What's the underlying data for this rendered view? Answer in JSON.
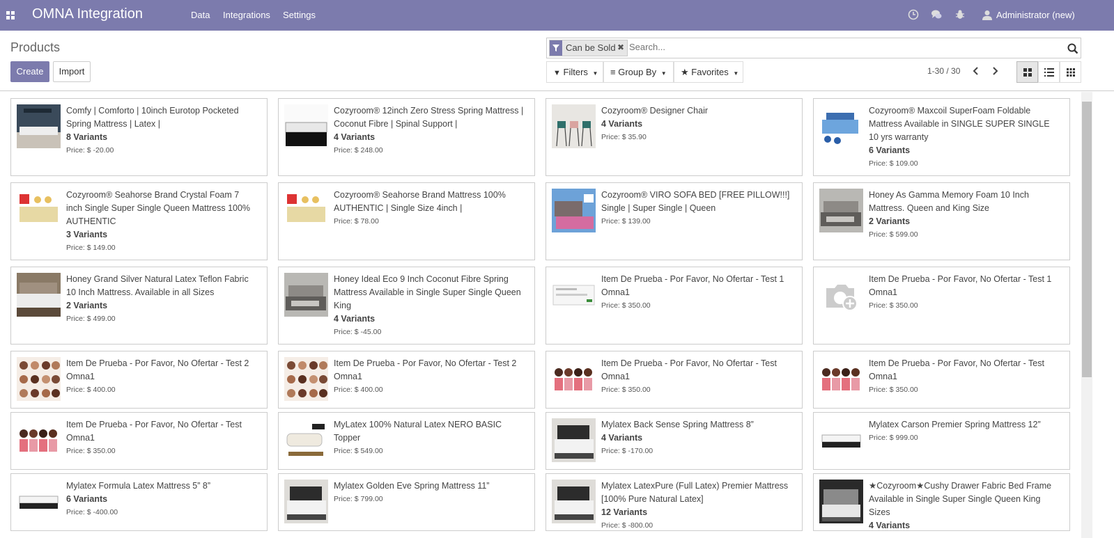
{
  "app": {
    "title": "OMNA Integration"
  },
  "nav": {
    "menus": [
      "Data",
      "Integrations",
      "Settings"
    ],
    "user": "Administrator (new)"
  },
  "control": {
    "breadcrumb": "Products",
    "create_label": "Create",
    "import_label": "Import",
    "facet_label": "Can be Sold",
    "search_placeholder": "Search...",
    "filters_label": "Filters",
    "groupby_label": "Group By",
    "favorites_label": "Favorites",
    "pager_text": "1-30 / 30"
  },
  "products": [
    {
      "l1": "Comfy | Comforto | 10inch Eurotop Pocketed",
      "l2": "Spring Mattress | Latex |",
      "l3": "",
      "variants": "8 Variants",
      "price": "Price: $ -20.00",
      "thumb": "mattress-dark"
    },
    {
      "l1": "Cozyroom® 12inch Zero Stress Spring Mattress |",
      "l2": "Coconut Fibre | Spinal Support |",
      "l3": "",
      "variants": "4 Variants",
      "price": "Price: $ 248.00",
      "thumb": "mattress-light"
    },
    {
      "l1": "Cozyroom® Designer Chair",
      "l2": "",
      "l3": "",
      "variants": "4 Variants",
      "price": "Price: $ 35.90",
      "thumb": "chairs"
    },
    {
      "l1": "Cozyroom® Maxcoil SuperFoam Foldable",
      "l2": "Mattress Available in SINGLE SUPER SINGLE",
      "l3": "10 yrs warranty",
      "variants": "6 Variants",
      "price": "Price: $ 109.00",
      "thumb": "foam-blue"
    },
    {
      "l1": "Cozyroom® Seahorse Brand Crystal Foam 7",
      "l2": "inch Single Super Single Queen Mattress 100%",
      "l3": "AUTHENTIC",
      "variants": "3 Variants",
      "price": "Price: $ 149.00",
      "thumb": "foam-yellow"
    },
    {
      "l1": "Cozyroom® Seahorse Brand Mattress 100%",
      "l2": "AUTHENTIC | Single Size 4inch |",
      "l3": "",
      "variants": "",
      "price": "Price: $ 78.00",
      "thumb": "foam-yellow"
    },
    {
      "l1": "Cozyroom® VIRO SOFA BED [FREE PILLOW!!!]",
      "l2": "Single | Super Single | Queen",
      "l3": "",
      "variants": "",
      "price": "Price: $ 139.00",
      "thumb": "sofa-pink"
    },
    {
      "l1": "Honey As Gamma Memory Foam 10 Inch",
      "l2": "Mattress. Queen and King Size",
      "l3": "",
      "variants": "2 Variants",
      "price": "Price: $ 599.00",
      "thumb": "bedroom-grey"
    },
    {
      "l1": "Honey Grand Silver Natural Latex Teflon Fabric",
      "l2": "10 Inch Mattress. Available in all Sizes",
      "l3": "",
      "variants": "2 Variants",
      "price": "Price: $ 499.00",
      "thumb": "bedroom-brown"
    },
    {
      "l1": "Honey Ideal Eco 9 Inch Coconut Fibre Spring",
      "l2": "Mattress Available in Single Super Single Queen",
      "l3": "King",
      "variants": "4 Variants",
      "price": "Price: $ -45.00",
      "thumb": "bedroom-grey"
    },
    {
      "l1": "Item De Prueba - Por Favor, No Ofertar - Test 1",
      "l2": "Omna1",
      "l3": "",
      "variants": "",
      "price": "Price: $ 350.00",
      "thumb": "screenshot"
    },
    {
      "l1": "Item De Prueba - Por Favor, No Ofertar - Test 1",
      "l2": "Omna1",
      "l3": "",
      "variants": "",
      "price": "Price: $ 350.00",
      "thumb": "camera"
    },
    {
      "l1": "Item De Prueba - Por Favor, No Ofertar - Test 2",
      "l2": "Omna1",
      "l3": "",
      "variants": "",
      "price": "Price: $ 400.00",
      "thumb": "people"
    },
    {
      "l1": "Item De Prueba - Por Favor, No Ofertar - Test 2",
      "l2": "Omna1",
      "l3": "",
      "variants": "",
      "price": "Price: $ 400.00",
      "thumb": "people"
    },
    {
      "l1": "Item De Prueba - Por Favor, No Ofertar - Test",
      "l2": "Omna1",
      "l3": "",
      "variants": "",
      "price": "Price: $ 350.00",
      "thumb": "people-pink"
    },
    {
      "l1": "Item De Prueba - Por Favor, No Ofertar - Test",
      "l2": "Omna1",
      "l3": "",
      "variants": "",
      "price": "Price: $ 350.00",
      "thumb": "people-pink"
    },
    {
      "l1": "Item De Prueba - Por Favor, No Ofertar - Test",
      "l2": "Omna1",
      "l3": "",
      "variants": "",
      "price": "Price: $ 350.00",
      "thumb": "people-pink"
    },
    {
      "l1": "MyLatex 100% Natural Latex NERO BASIC",
      "l2": "Topper",
      "l3": "",
      "variants": "",
      "price": "Price: $ 549.00",
      "thumb": "topper"
    },
    {
      "l1": "Mylatex Back Sense Spring Mattress 8”",
      "l2": "",
      "l3": "",
      "variants": "4 Variants",
      "price": "Price: $ -170.00",
      "thumb": "bedroom-dark"
    },
    {
      "l1": "Mylatex Carson Premier Spring Mattress 12”",
      "l2": "",
      "l3": "",
      "variants": "",
      "price": "Price: $ 999.00",
      "thumb": "mattress-white"
    },
    {
      "l1": "Mylatex Formula Latex Mattress 5” 8”",
      "l2": "",
      "l3": "",
      "variants": "6 Variants",
      "price": "Price: $ -400.00",
      "thumb": "mattress-white"
    },
    {
      "l1": "Mylatex Golden Eve Spring Mattress 11”",
      "l2": "",
      "l3": "",
      "variants": "",
      "price": "Price: $ 799.00",
      "thumb": "bedroom-dark"
    },
    {
      "l1": "Mylatex LatexPure (Full Latex) Premier Mattress",
      "l2": "[100% Pure Natural Latex]",
      "l3": "",
      "variants": "12 Variants",
      "price": "Price: $ -800.00",
      "thumb": "bedroom-dark"
    },
    {
      "l1": "★Cozyroom★Cushy Drawer Fabric Bed Frame",
      "l2": "Available in Single Super Single Queen King",
      "l3": "Sizes",
      "variants": "4 Variants",
      "price": "",
      "thumb": "bedframe"
    }
  ]
}
